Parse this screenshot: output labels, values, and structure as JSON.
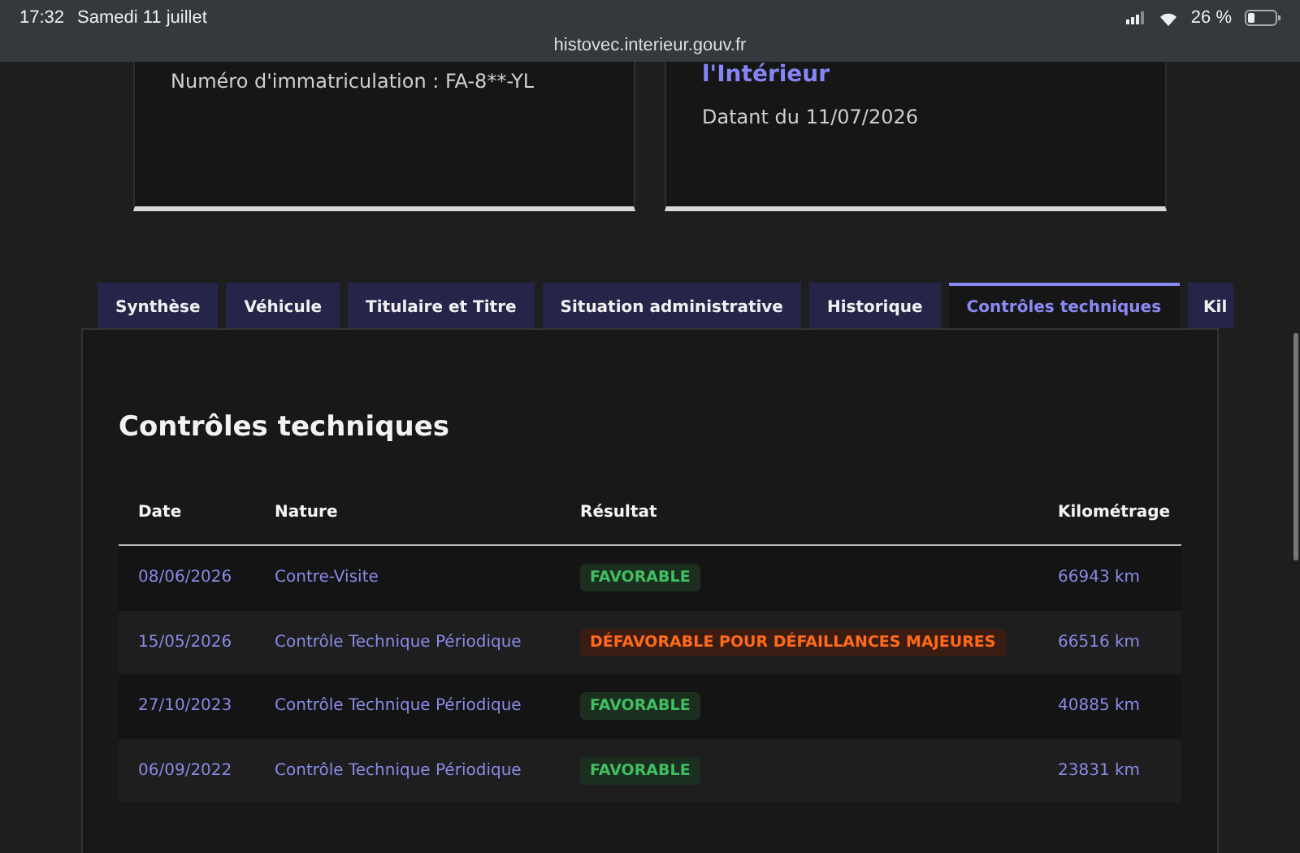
{
  "status_bar": {
    "time": "17:32",
    "date": "Samedi 11 juillet",
    "battery": "26 %",
    "url": "histovec.interieur.gouv.fr"
  },
  "cards": [
    {
      "lines": [
        {
          "kind": "text",
          "text": "Numéro d'immatriculation : FA-8**-YL"
        }
      ]
    },
    {
      "lines": [
        {
          "kind": "title",
          "text": "l'Intérieur"
        },
        {
          "kind": "text",
          "text": "Datant du 11/07/2026"
        }
      ]
    }
  ],
  "tabs": [
    {
      "label": "Synthèse",
      "selected": false
    },
    {
      "label": "Véhicule",
      "selected": false
    },
    {
      "label": "Titulaire et Titre",
      "selected": false
    },
    {
      "label": "Situation administrative",
      "selected": false
    },
    {
      "label": "Historique",
      "selected": false
    },
    {
      "label": "Contrôles techniques",
      "selected": true
    },
    {
      "label": "Kil",
      "selected": false
    }
  ],
  "section": {
    "title": "Contrôles techniques"
  },
  "table": {
    "columns": [
      "Date",
      "Nature",
      "Résultat",
      "Kilométrage"
    ],
    "rows": [
      {
        "date": "08/06/2026",
        "nature": "Contre-Visite",
        "result": {
          "kind": "favorable",
          "text": "FAVORABLE"
        },
        "km": "66943 km"
      },
      {
        "date": "15/05/2026",
        "nature": "Contrôle Technique Périodique",
        "result": {
          "kind": "unfavorable",
          "text": "DÉFAVORABLE POUR DÉFAILLANCES MAJEURES"
        },
        "km": "66516 km"
      },
      {
        "date": "27/10/2023",
        "nature": "Contrôle Technique Périodique",
        "result": {
          "kind": "favorable",
          "text": "FAVORABLE"
        },
        "km": "40885 km"
      },
      {
        "date": "06/09/2022",
        "nature": "Contrôle Technique Périodique",
        "result": {
          "kind": "favorable",
          "text": "FAVORABLE"
        },
        "km": "23831 km"
      }
    ]
  }
}
